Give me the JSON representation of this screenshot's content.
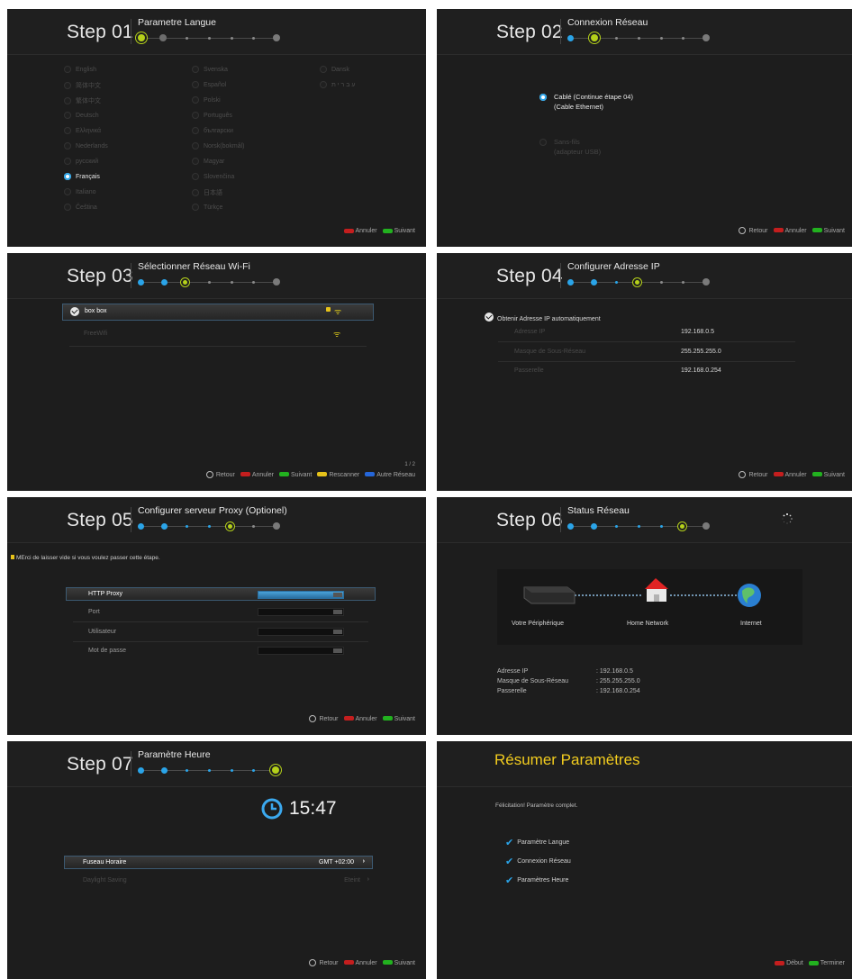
{
  "footer_labels": {
    "retour": "Retour",
    "annuler": "Annuler",
    "suivant": "Suivant",
    "rescanner": "Rescanner",
    "autre_reseau": "Autre Réseau",
    "debut": "Début",
    "terminer": "Terminer"
  },
  "colors": {
    "accent_blue": "#2aa4e8",
    "current_green": "#b5d11a",
    "key_red": "#c41e1e",
    "key_green": "#22b11f",
    "key_yellow": "#e6c21a",
    "key_blue": "#2566d9",
    "summary_title": "#f2cc1f"
  },
  "step1": {
    "step_word": "Step",
    "step_num": "01",
    "title": "Parametre Langue",
    "languages": [
      "English",
      "简体中文",
      "繁体中文",
      "Deutsch",
      "Ελληνικά",
      "Nederlands",
      "русский",
      "Français",
      "Italiano",
      "Čeština",
      "Svenska",
      "Español",
      "Polski",
      "Português",
      "български",
      "Norsk(bokmål)",
      "Magyar",
      "Slovenčina",
      "日本語",
      "Türkçe",
      "Dansk",
      "ע ב ר י ת"
    ],
    "selected": "Français"
  },
  "step2": {
    "step_word": "Step",
    "step_num": "02",
    "title": "Connexion Réseau",
    "option1_line1": "Cablé (Continue étape 04)",
    "option1_line2": "(Cable Ethernet)",
    "option2_line1": "Sans-fils",
    "option2_line2": "(adapteur USB)"
  },
  "step3": {
    "step_word": "Step",
    "step_num": "03",
    "title": "Sélectionner Réseau Wi-Fi",
    "networks": [
      "box box",
      "FreeWifi"
    ],
    "page": "1 / 2"
  },
  "step4": {
    "step_word": "Step",
    "step_num": "04",
    "title": "Configurer Adresse IP",
    "auto_label": "Obtenir Adresse IP automatiquement",
    "ip_label": "Adresse IP",
    "ip_value": "192.168.0.5",
    "mask_label": "Masque de Sous-Réseau",
    "mask_value": "255.255.255.0",
    "gateway_label": "Passerelle",
    "gateway_value": "192.168.0.254"
  },
  "step5": {
    "step_word": "Step",
    "step_num": "05",
    "title": "Configurer serveur Proxy (Optionel)",
    "note": "MErci de laisser vide si vous voulez passer cette étape.",
    "http_proxy": "HTTP Proxy",
    "port": "Port",
    "utilisateur": "Utilisateur",
    "mot_de_passe": "Mot de passe"
  },
  "step6": {
    "step_word": "Step",
    "step_num": "06",
    "title": "Status Réseau",
    "device_label": "Votre Périphérique",
    "home_label": "Home Network",
    "internet_label": "Internet",
    "ip_label": "Adresse IP",
    "ip_value": ": 192.168.0.5",
    "mask_label": "Masque de Sous-Réseau",
    "mask_value": ": 255.255.255.0",
    "gateway_label": "Passerelle",
    "gateway_value": ": 192.168.0.254"
  },
  "step7": {
    "step_word": "Step",
    "step_num": "07",
    "title": "Paramètre Heure",
    "time": "15:47",
    "fuseau_label": "Fuseau Horaire",
    "fuseau_value": "GMT +02:00",
    "daylight_label": "Daylight Saving",
    "daylight_value": "Eteint"
  },
  "summary": {
    "title": "Résumer Paramètres",
    "message": "Félicitation! Paramètre complet.",
    "items": [
      "Paramètre Langue",
      "Connexion Réseau",
      "Paramètres Heure"
    ]
  }
}
